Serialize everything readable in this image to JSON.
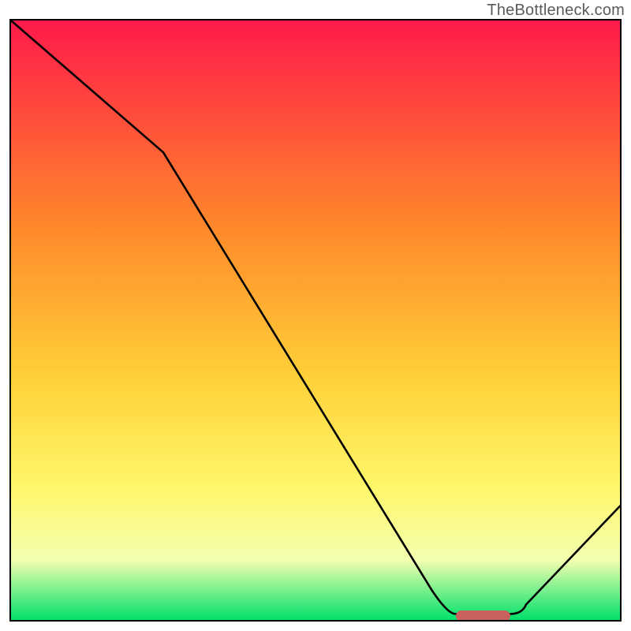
{
  "watermark": "TheBottleneck.com",
  "colors": {
    "top": "#ff1a4a",
    "mid1": "#ff6e3a",
    "mid2": "#ffd23a",
    "mid3": "#fff76b",
    "near_bottom": "#f4ffb0",
    "bottom": "#00e06a",
    "curve": "#000000",
    "marker": "#c9615e",
    "frame": "#000000"
  },
  "chart_data": {
    "type": "line",
    "title": "",
    "xlabel": "",
    "ylabel": "",
    "xlim": [
      0,
      100
    ],
    "ylim": [
      0,
      100
    ],
    "x": [
      0,
      25,
      73,
      82,
      100
    ],
    "values": [
      100,
      78,
      1,
      1,
      19
    ],
    "marker_x_range": [
      73,
      82
    ],
    "marker_y": 0.6,
    "gradient_stops": [
      {
        "pos": 0,
        "color": "#ff1a4a"
      },
      {
        "pos": 35,
        "color": "#ff8a2a"
      },
      {
        "pos": 60,
        "color": "#ffd23a"
      },
      {
        "pos": 78,
        "color": "#fff76b"
      },
      {
        "pos": 90,
        "color": "#f4ffb0"
      },
      {
        "pos": 100,
        "color": "#00e06a"
      }
    ]
  }
}
